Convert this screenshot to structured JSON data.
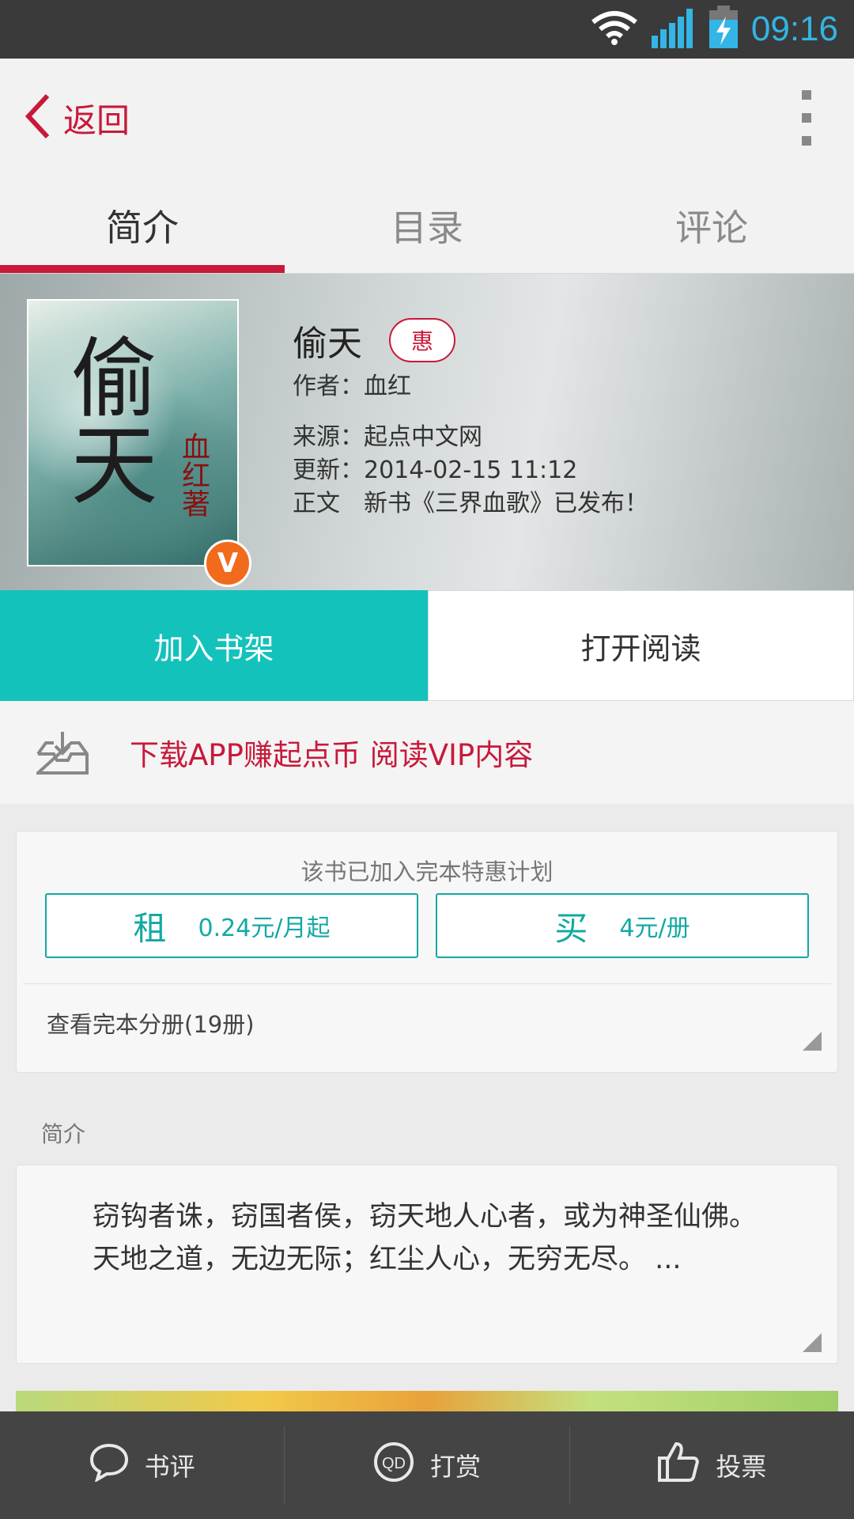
{
  "status_bar": {
    "time": "09:16"
  },
  "topbar": {
    "back_label": "返回"
  },
  "tabs": [
    {
      "label": "简介",
      "active": true
    },
    {
      "label": "目录",
      "active": false
    },
    {
      "label": "评论",
      "active": false
    }
  ],
  "book": {
    "title": "偷天",
    "promo_tag": "惠",
    "author_line": "作者：血红",
    "source_line": "来源：起点中文网",
    "update_line": "更新：2014-02-15 11:12",
    "latest_line": "正文　新书《三界血歌》已发布！",
    "cover_title": "偷天",
    "cover_author": "血红著",
    "vip_badge": "V"
  },
  "actions": {
    "add_shelf": "加入书架",
    "open_read": "打开阅读"
  },
  "download_banner": {
    "text": "下载APP赚起点币 阅读VIP内容"
  },
  "plan": {
    "title": "该书已加入完本特惠计划",
    "rent_label": "租",
    "rent_price": "0.24元/月起",
    "buy_label": "买",
    "buy_price": "4元/册",
    "volumes_link": "查看完本分册(19册)"
  },
  "intro": {
    "section_label": "简介",
    "paragraph_1": "窃钩者诛，窃国者侯，窃天地人心者，或为神圣仙佛。",
    "paragraph_2": "天地之道，无边无际；红尘人心，无穷无尽。 ..."
  },
  "bottom_bar": {
    "review": "书评",
    "reward": "打赏",
    "vote": "投票"
  },
  "colors": {
    "accent_red": "#c8193a",
    "teal": "#13c2bb",
    "status_blue": "#33b5e5"
  }
}
